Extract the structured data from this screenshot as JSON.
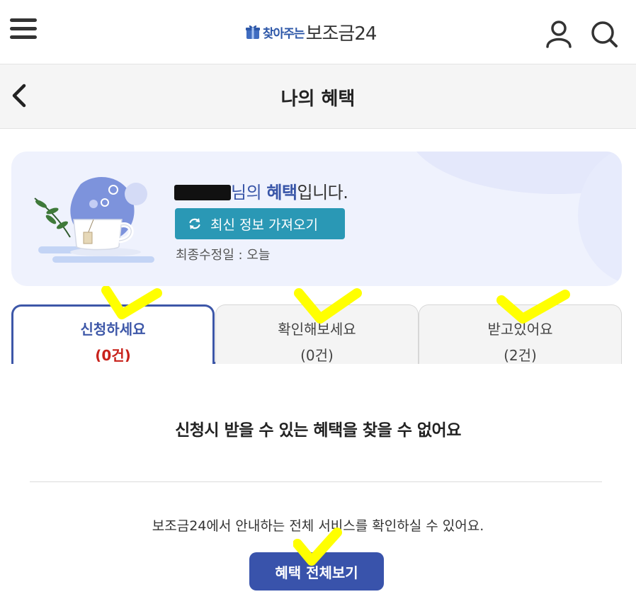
{
  "header": {
    "logo_small": "찾아주는",
    "logo_big": "보조금24"
  },
  "page": {
    "title": "나의 혜택"
  },
  "profile": {
    "name_suffix": "님의",
    "benefit_word": "혜택",
    "sentence_end": "입니다.",
    "refresh_label": "최신 정보 가져오기",
    "updated_label": "최종수정일 : 오늘"
  },
  "tabs": [
    {
      "label": "신청하세요",
      "count": "(0건)",
      "active": true
    },
    {
      "label": "확인해보세요",
      "count": "(0건)",
      "active": false
    },
    {
      "label": "받고있어요",
      "count": "(2건)",
      "active": false
    }
  ],
  "content": {
    "empty_message": "신청시 받을 수 있는 혜택을 찾을 수 없어요",
    "info_text": "보조금24에서 안내하는 전체 서비스를 확인하실 수 있어요.",
    "all_button": "혜택 전체보기"
  },
  "colors": {
    "accent": "#3d57a8",
    "teal_button": "#2a98b5",
    "count_red": "#c8221b",
    "annotation": "#ffff00"
  },
  "icons": [
    "hamburger-menu-icon",
    "gift-icon",
    "user-icon",
    "search-icon",
    "chevron-left-icon",
    "refresh-icon",
    "teacup-illustration"
  ]
}
